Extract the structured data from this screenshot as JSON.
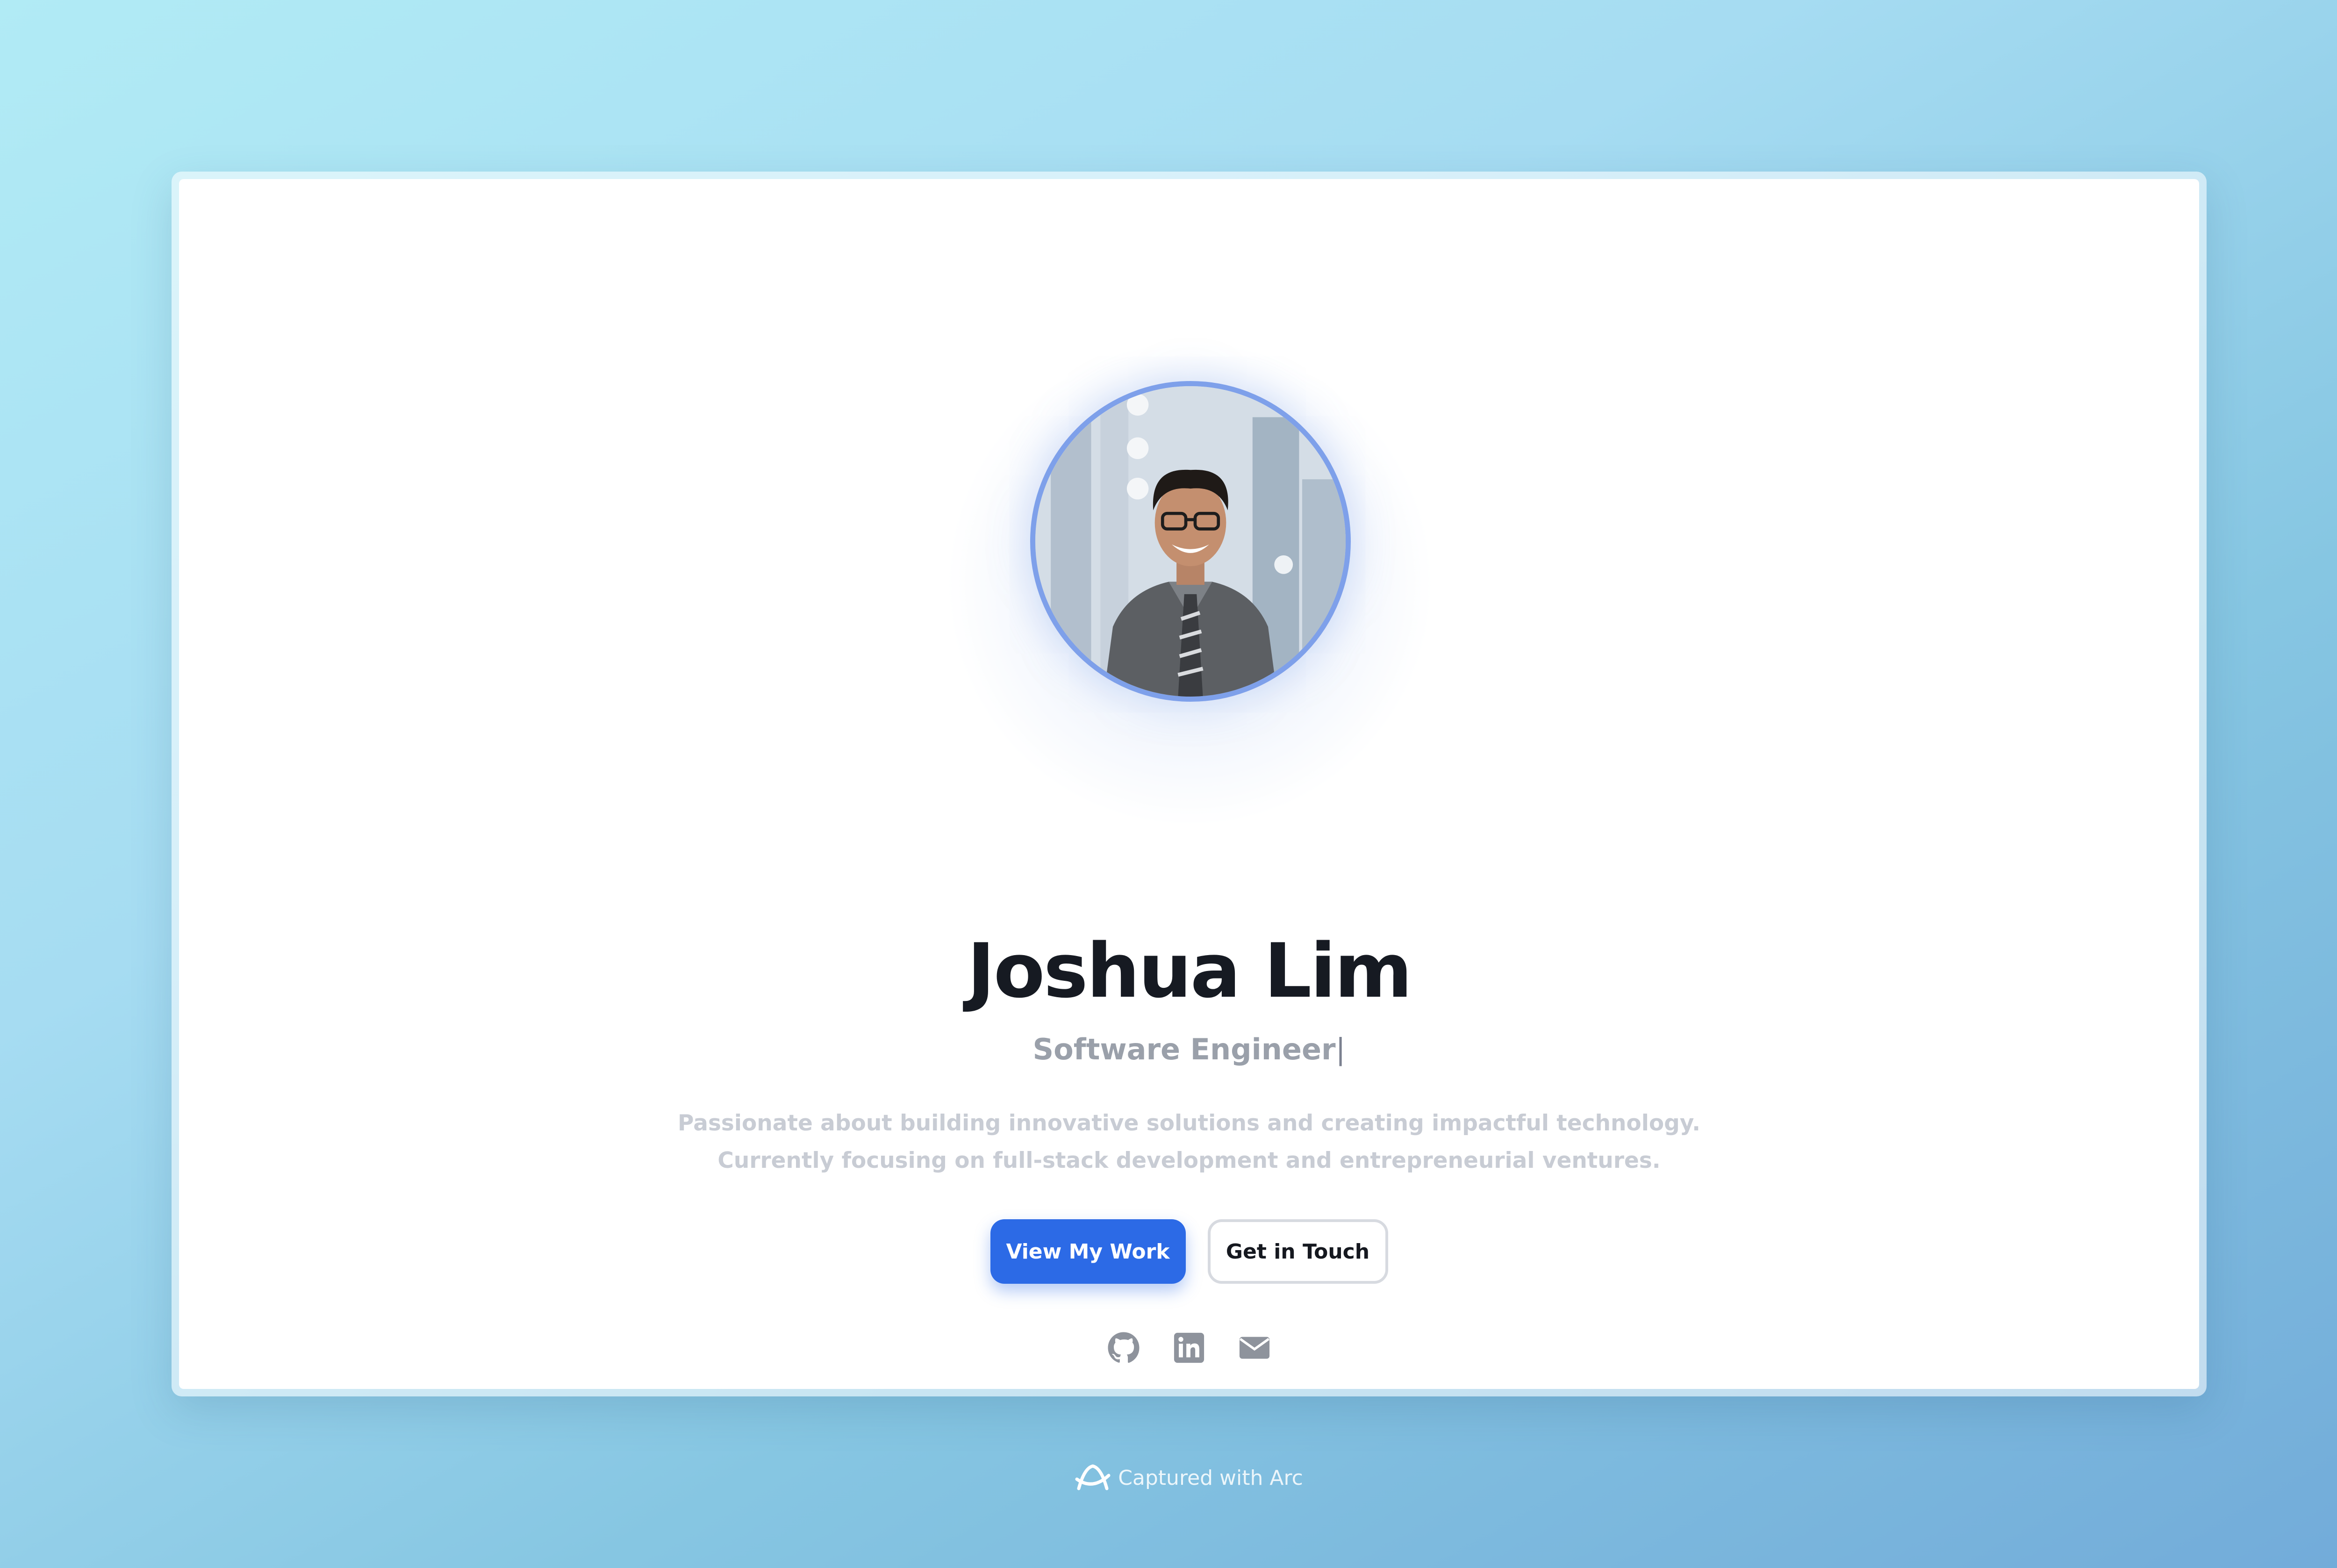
{
  "profile": {
    "name": "Joshua Lim",
    "role": "Software Engineer",
    "cursor": "|",
    "bio_line1": "Passionate about building innovative solutions and creating impactful technology.",
    "bio_line2": "Currently focusing on full-stack development and entrepreneurial ventures."
  },
  "actions": {
    "primary_label": "View My Work",
    "secondary_label": "Get in Touch"
  },
  "socials": [
    "github-icon",
    "linkedin-icon",
    "mail-icon"
  ],
  "footer": {
    "caption": "Captured with Arc"
  },
  "colors": {
    "accent": "#2c6ae6",
    "avatar_ring": "#7ea0ea",
    "name": "#161a22",
    "muted": "#9aa0aa",
    "icons": "#8e939c"
  }
}
